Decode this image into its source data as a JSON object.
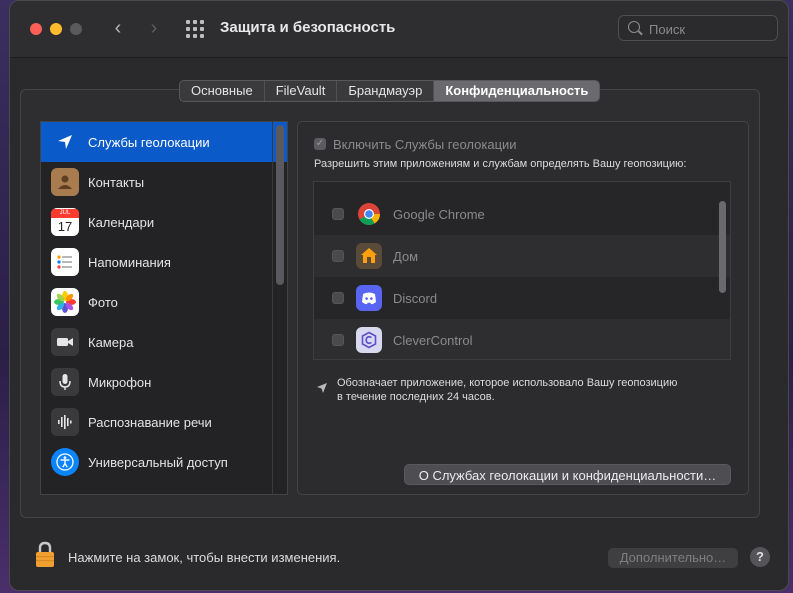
{
  "window": {
    "title": "Защита и безопасность",
    "back_glyph": "‹",
    "forward_glyph": "›"
  },
  "search": {
    "placeholder": "Поиск"
  },
  "tabs": [
    {
      "label": "Основные"
    },
    {
      "label": "FileVault"
    },
    {
      "label": "Брандмауэр"
    },
    {
      "label": "Конфиденциальность",
      "active": true
    }
  ],
  "sidebar": {
    "items": [
      {
        "label": "Службы геолокации",
        "icon": "location-arrow-icon",
        "selected": true
      },
      {
        "label": "Контакты",
        "icon": "contacts-icon"
      },
      {
        "label": "Календари",
        "icon": "calendar-icon",
        "month": "JUL",
        "day": "17"
      },
      {
        "label": "Напоминания",
        "icon": "reminders-icon"
      },
      {
        "label": "Фото",
        "icon": "photos-icon"
      },
      {
        "label": "Камера",
        "icon": "camera-icon"
      },
      {
        "label": "Микрофон",
        "icon": "microphone-icon"
      },
      {
        "label": "Распознавание речи",
        "icon": "speech-recognition-icon"
      },
      {
        "label": "Универсальный доступ",
        "icon": "accessibility-icon"
      }
    ]
  },
  "location": {
    "enable_label": "Включить Службы геолокации",
    "enable_checked": true,
    "description": "Разрешить этим приложениям и службам определять Вашу геопозицию:",
    "apps": [
      {
        "name": "Google Chrome",
        "icon": "chrome-icon",
        "checked": false
      },
      {
        "name": "Дом",
        "icon": "home-app-icon",
        "checked": false
      },
      {
        "name": "Discord",
        "icon": "discord-icon",
        "checked": false
      },
      {
        "name": "CleverControl",
        "icon": "clevercontrol-icon",
        "checked": false
      }
    ],
    "note_line1": "Обозначает приложение, которое использовало Вашу геопозицию",
    "note_line2": "в течение последних 24 часов.",
    "about_button": "О Службах геолокации и конфиденциальности…"
  },
  "footer": {
    "lock_label": "Нажмите на замок, чтобы внести изменения.",
    "advanced_button": "Дополнительно…",
    "help_button": "?"
  },
  "colors": {
    "accent": "#0a5ac9",
    "close": "#fe5f57",
    "minimize": "#febc2e"
  }
}
